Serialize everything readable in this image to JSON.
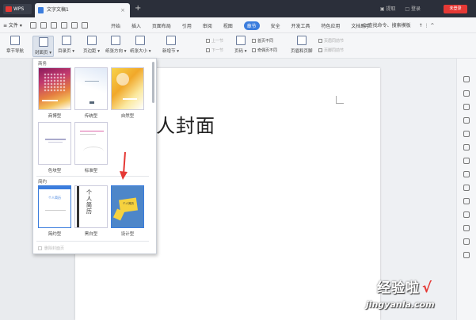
{
  "title_bar": {
    "app_tab": "WPS",
    "doc_tab": "文字文稿1",
    "close_symbol": "×",
    "new_tab_symbol": "+",
    "right_items": [
      "▣ 提取",
      "□ 登录"
    ],
    "login_button": "未登录"
  },
  "menu_bar": {
    "file_menu": "≡ 文件 ▾",
    "items": [
      "开始",
      "插入",
      "页面布局",
      "引用",
      "审阅",
      "视图",
      "章节",
      "安全",
      "开发工具",
      "特色应用",
      "文档助手"
    ],
    "active_item": "章节",
    "search": "Q 查找命令、搜索模板",
    "right_icons": "↑ ⋮ ^"
  },
  "ribbon": {
    "buttons": [
      "章节导航",
      "封面页 ▾",
      "目录页 ▾",
      "页边距 ▾",
      "纸张方向 ▾",
      "纸张大小 ▾",
      "新增节 ▾",
      "页码 ▾",
      "页眉和页脚"
    ],
    "selected": "封面页 ▾",
    "small": [
      "上一节",
      "下一节",
      "首页不同",
      "奇偶页不同",
      "页眉同前节",
      "页脚同前节"
    ]
  },
  "document": {
    "title_text": "人封面"
  },
  "dropdown": {
    "section_recommended": "商务",
    "section_simple": "简约",
    "templates_row1": [
      "商博型",
      "传统型",
      "自然型"
    ],
    "templates_row2": [
      "色块型",
      "标准型"
    ],
    "templates_row3": [
      "简约型",
      "黑白型",
      "设计型"
    ],
    "thumb_text": {
      "personal_resume": "个人简历",
      "vertical_title": [
        "个",
        "人",
        "简",
        "历"
      ],
      "design_badge": "个人简历"
    },
    "delete_label": "删除封面页"
  },
  "watermark": {
    "cn": "经验啦",
    "check": "√",
    "url": "jingyanla.com"
  },
  "colors": {
    "accent": "#3b7ddd",
    "title_bar": "#2b2f3a",
    "arrow_red": "#e53935"
  }
}
